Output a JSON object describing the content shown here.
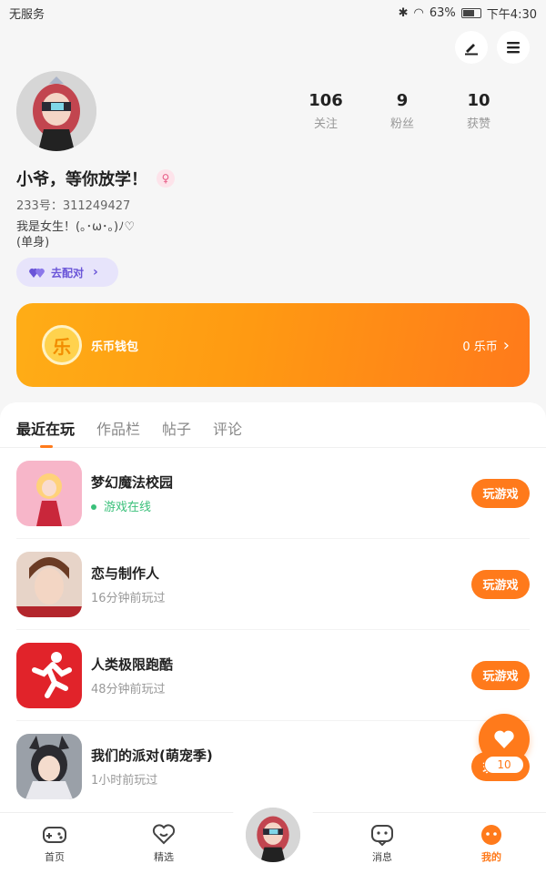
{
  "status_bar": {
    "carrier": "无服务",
    "battery": "63%",
    "time": "下午4:30"
  },
  "profile": {
    "stats": [
      {
        "value": "106",
        "label": "关注"
      },
      {
        "value": "9",
        "label": "粉丝"
      },
      {
        "value": "10",
        "label": "获赞"
      }
    ],
    "nickname": "小爷，等你放学！",
    "gender_symbol": "♀",
    "uid": "233号：311249427",
    "bio_line1": "我是女生！(｡･ω･｡)ﾉ♡",
    "bio_line2": "(单身)",
    "match_button": "去配对"
  },
  "wallet": {
    "label": "乐币钱包",
    "coin_glyph": "乐",
    "balance": "0 乐币"
  },
  "tabs": [
    "最近在玩",
    "作品栏",
    "帖子",
    "评论"
  ],
  "games": [
    {
      "name": "梦幻魔法校园",
      "status": "游戏在线",
      "button": "玩游戏"
    },
    {
      "name": "恋与制作人",
      "status": "16分钟前玩过",
      "button": "玩游戏"
    },
    {
      "name": "人类极限跑酷",
      "status": "48分钟前玩过",
      "button": "玩游戏"
    },
    {
      "name": "我们的派对(萌宠季)",
      "status": "1小时前玩过",
      "button": "玩游戏"
    }
  ],
  "like_fab": {
    "count": "10"
  },
  "bottom_nav": [
    "首页",
    "精选",
    "消息",
    "我的"
  ],
  "colors": {
    "accent": "#ff7a1b",
    "online": "#3ac07a",
    "match": "#6a55d8"
  }
}
